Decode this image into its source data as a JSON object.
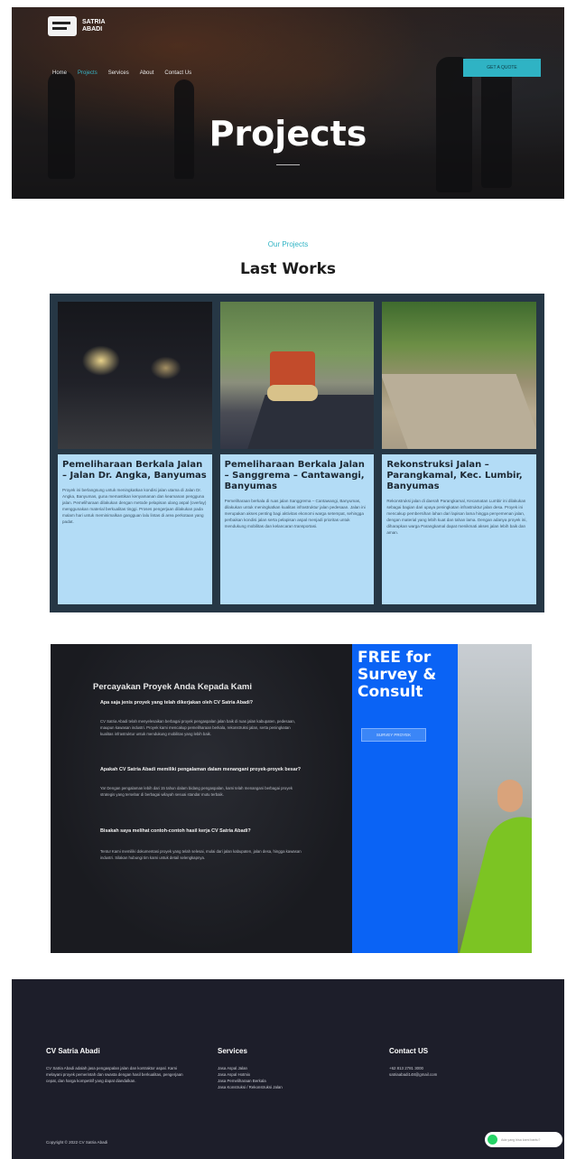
{
  "header": {
    "logo_text": "SATRIA ABADI",
    "nav": [
      "Home",
      "Projects",
      "Services",
      "About",
      "Contact Us"
    ],
    "active_nav": "Projects",
    "cta_label": "GET A QUOTE",
    "hero_title": "Projects"
  },
  "projects": {
    "subtitle": "Our Projects",
    "title": "Last Works",
    "cards": [
      {
        "title": "Pemeliharaan Berkala Jalan – Jalan Dr. Angka, Banyumas",
        "text": "Proyek ini berlangsung untuk meningkatkan kondisi jalan utama di Jalan Dr. Angka, Banyumas, guna memastikan kenyamanan dan keamanan pengguna jalan. Pemeliharaan dilakukan dengan metode pelapisan ulang aspal (overlay) menggunakan material berkualitas tinggi. Proses pengerjaan dilakukan pada malam hari untuk meminimalkan gangguan lalu lintas di area perkotaan yang padat."
      },
      {
        "title": "Pemeliharaan Berkala Jalan – Sanggrema – Cantawangi, Banyumas",
        "text": "Pemeliharaan berkala di ruas jalan Sanggrema – Cantawangi, Banyumas, dilakukan untuk meningkatkan kualitas infrastruktur jalan pedesaan. Jalan ini merupakan akses penting bagi aktivitas ekonomi warga setempat, sehingga perbaikan kondisi jalan serta pelapisan aspal menjadi prioritas untuk mendukung mobilitas dan kelancaran transportasi."
      },
      {
        "title": "Rekonstruksi Jalan – Parangkamal, Kec. Lumbir, Banyumas",
        "text": "Rekonstruksi jalan di daerah Parangkamal, Kecamatan Lumbir ini dilakukan sebagai bagian dari upaya peningkatan infrastruktur jalan desa. Proyek ini mencakup pembersihan lahan dari lapisan lama hingga penyemenan jalan, dengan material yang lebih kuat dan tahan lama. Dengan adanya proyek ini, diharapkan warga Parangkamal dapat menikmati akses jalan lebih baik dan aman."
      }
    ]
  },
  "consult": {
    "title": "Percayakan Proyek Anda Kepada Kami",
    "q1": "Apa saja jenis proyek yang telah dikerjakan oleh CV Satria Abadi?",
    "a1": "CV Satria Abadi telah menyelesaikan berbagai proyek pengaspalan jalan baik di ruas jalan kabupaten, pedesaan, maupun kawasan industri. Proyek kami mencakup pemeliharaan berkala, rekonstruksi jalan, serta peningkatan kualitas infrastruktur untuk mendukung mobilitas yang lebih baik.",
    "q2": "Apakah CV Satria Abadi memiliki pengalaman dalam menangani proyek-proyek besar?",
    "a2": "Ya! Dengan pengalaman lebih dari 15 tahun dalam bidang pengaspalan, kami telah menangani berbagai proyek strategis yang tersebar di berbagai wilayah sesuai standar mutu terbaik.",
    "q3": "Bisakah saya melihat contoh-contoh hasil kerja CV Satria Abadi?",
    "a3": "Tentu! Kami memiliki dokumentasi proyek yang telah selesai, mulai dari jalan kabupaten, jalan desa, hingga kawasan industri. Silakan hubungi tim kami untuk detail selengkapnya.",
    "free_text": "FREE for Survey & Consult",
    "button": "SURVEY PROYEK"
  },
  "footer": {
    "col1_title": "CV Satria Abadi",
    "col1_text": "CV Satria Abadi adalah jasa pengaspalan jalan dan kontraktor aspal. Kami melayani proyek pemerintah dan swasta dengan hasil berkualitas, pengerjaan cepat, dan harga kompetitif yang dapat diandalkan.",
    "col2_title": "Services",
    "services": [
      "Jasa Aspal Jalan",
      "Jasa Aspal Hotmix",
      "Jasa Pemeliharaan Berkala",
      "Jasa Konstruksi / Rekonstruksi Jalan"
    ],
    "col3_title": "Contact US",
    "phone": "+62 813 2781 3000",
    "email": "satriaabadi148@gmail.com",
    "copyright": "Copyright © 2022 CV Satria Abadi",
    "whatsapp": "Ada yang bisa kami bantu?"
  }
}
